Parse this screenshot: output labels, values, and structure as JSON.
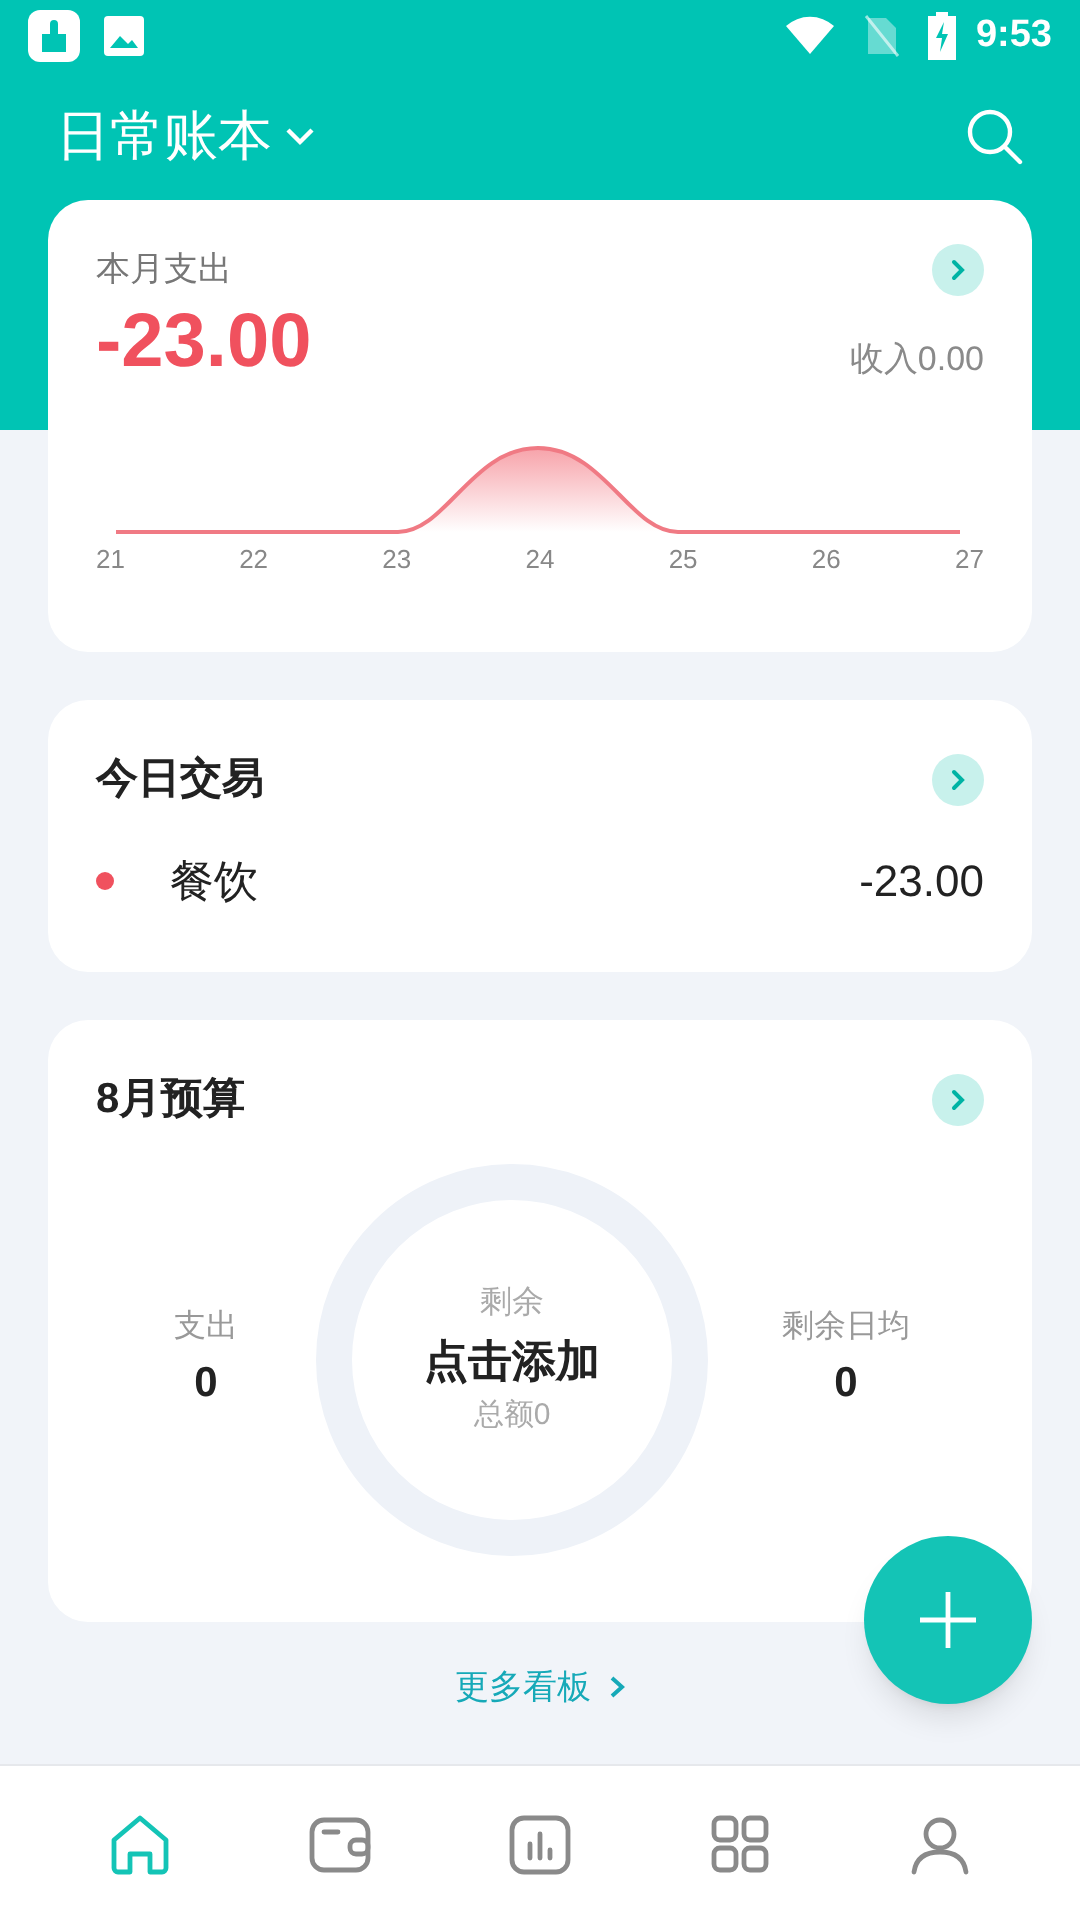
{
  "status_bar": {
    "time": "9:53"
  },
  "header": {
    "title": "日常账本"
  },
  "month_card": {
    "label": "本月支出",
    "amount": "-23.00",
    "income": "收入0.00",
    "days": [
      "21",
      "22",
      "23",
      "24",
      "25",
      "26",
      "27"
    ]
  },
  "today_card": {
    "title": "今日交易",
    "items": [
      {
        "category": "餐饮",
        "amount": "-23.00",
        "color": "#f0515e"
      }
    ]
  },
  "budget_card": {
    "title": "8月预算",
    "left_label": "支出",
    "left_value": "0",
    "ring_top": "剩余",
    "ring_main": "点击添加",
    "ring_bottom": "总额0",
    "right_label": "剩余日均",
    "right_value": "0"
  },
  "more_link": "更多看板",
  "nav": [
    {
      "kind": "home",
      "selected": true
    },
    {
      "kind": "wallet",
      "selected": false
    },
    {
      "kind": "stats",
      "selected": false
    },
    {
      "kind": "grid",
      "selected": false
    },
    {
      "kind": "profile",
      "selected": false
    }
  ]
}
